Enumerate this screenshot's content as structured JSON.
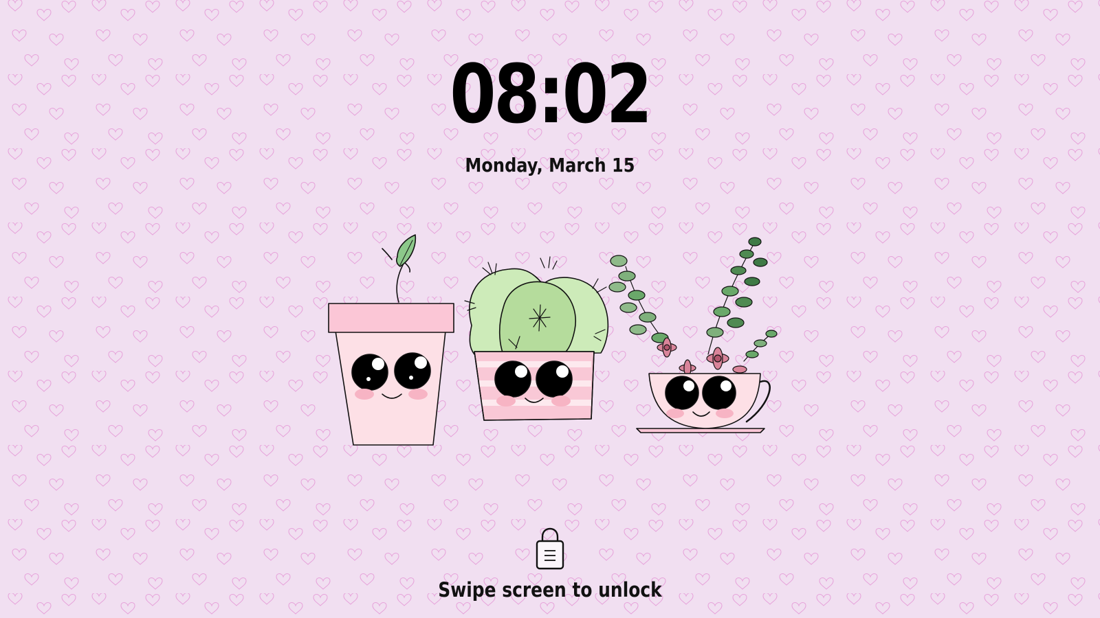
{
  "lockscreen": {
    "time": "08:02",
    "date": "Monday, March 15",
    "unlock_hint": "Swipe screen to unlock"
  },
  "wallpaper": {
    "theme": "heart-pattern-with-cute-potted-plants",
    "background_color": "#f1dff1",
    "heart_color": "#e8a6dc"
  },
  "icons": {
    "lock": "lock-icon"
  }
}
